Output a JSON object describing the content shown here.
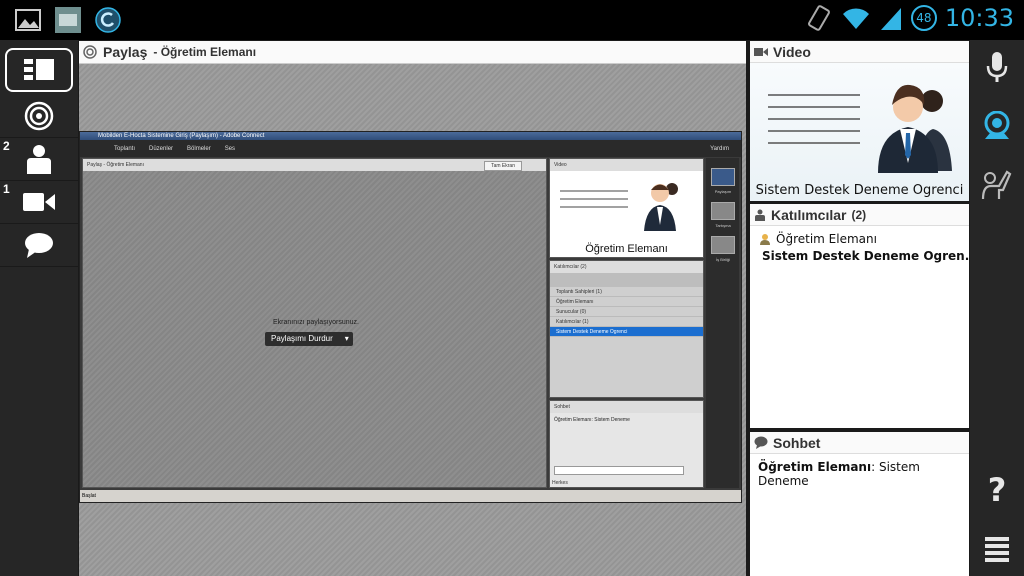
{
  "statusbar": {
    "clock": "10:33",
    "battery": "48",
    "icons": [
      "gallery-icon",
      "app-icon",
      "refresh-icon",
      "rotate-icon",
      "wifi-icon",
      "signal-icon"
    ]
  },
  "leftrail": {
    "items": [
      {
        "name": "layout-icon",
        "badge": ""
      },
      {
        "name": "target-icon",
        "badge": ""
      },
      {
        "name": "person-icon",
        "badge": "2"
      },
      {
        "name": "camera-icon",
        "badge": "1"
      },
      {
        "name": "chat-icon",
        "badge": ""
      }
    ]
  },
  "share": {
    "title": "Paylaş",
    "subtitle": "- Öğretim Elemanı"
  },
  "inner": {
    "window_title": "Mobilden E-Hocta Sistemine Giriş (Paylaşım) - Adobe Connect",
    "menu": [
      "Toplantı",
      "Düzenler",
      "Bölmeler",
      "Ses"
    ],
    "help": "Yardım",
    "share_head": "Paylaş   - Öğretim Elemanı",
    "stop_button_label_small": "Tam Ekran",
    "sharing_text": "Ekranınızı paylaşıyorsunuz.",
    "stop_button": "Paylaşımı Durdur",
    "video_head": "Video",
    "video_name": "Öğretim Elemanı",
    "attendees_head": "Katılımcılar (2)",
    "hosts_group": "Toplantı Sahipleri (1)",
    "host_name": "Öğretim Elemanı",
    "presenters_group": "Sunucular (0)",
    "participants_group": "Katılımcılar (1)",
    "participant_name": "Sistem Destek Deneme Ogrenci",
    "chat_head": "Sohbet",
    "chat_msg": "Öğretim Elemanı: Sistem Deneme",
    "chat_tab": "Herkes",
    "rail_labels": [
      "Paylaşım",
      "Tartışma",
      "İş Birliği"
    ],
    "start": "Başlat"
  },
  "video": {
    "title": "Video",
    "name": "Sistem Destek Deneme Ogrenci"
  },
  "attendees": {
    "title": "Katılımcılar",
    "count": "(2)",
    "rows": [
      {
        "label": "Öğretim Elemanı",
        "bold": false
      },
      {
        "label": "Sistem Destek Deneme Ogren...",
        "bold": true
      }
    ]
  },
  "chat": {
    "title": "Sohbet",
    "sender": "Öğretim Elemanı",
    "message": ": Sistem Deneme"
  },
  "rightrail": {
    "items": [
      "microphone-icon",
      "webcam-icon",
      "raise-hand-icon",
      "help-icon",
      "menu-icon"
    ],
    "help_label": "?"
  },
  "colors": {
    "accent": "#33b5e5",
    "rail_bg": "#262626",
    "selection": "#1b6ed0"
  }
}
